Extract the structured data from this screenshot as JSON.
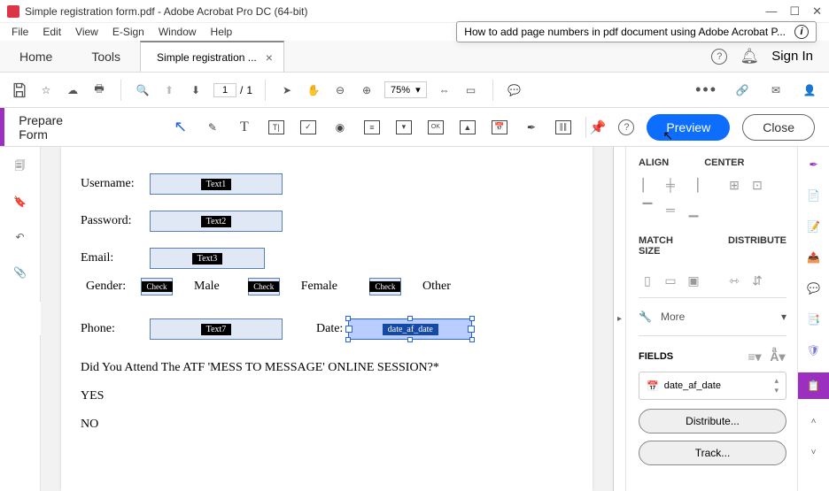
{
  "titlebar": {
    "text": "Simple registration form.pdf - Adobe Acrobat Pro DC (64-bit)"
  },
  "search_overlay": {
    "text": "How to add page numbers in pdf document using Adobe Acrobat P..."
  },
  "menubar": {
    "file": "File",
    "edit": "Edit",
    "view": "View",
    "esign": "E-Sign",
    "window": "Window",
    "help": "Help"
  },
  "tabbar": {
    "home": "Home",
    "tools": "Tools",
    "doc": "Simple registration ...",
    "signin": "Sign In"
  },
  "maintoolbar": {
    "page_cur": "1",
    "page_sep": "/",
    "page_total": "1",
    "zoom": "75%"
  },
  "formtoolbar": {
    "label": "Prepare Form",
    "preview": "Preview",
    "close": "Close"
  },
  "form": {
    "username_label": "Username:",
    "username_tag": "Text1",
    "password_label": "Password:",
    "password_tag": "Text2",
    "email_label": "Email:",
    "email_tag": "Text3",
    "gender_label": "Gender:",
    "check_tag": "Check",
    "male": "Male",
    "female": "Female",
    "other": "Other",
    "phone_label": "Phone:",
    "phone_tag": "Text7",
    "date_label": "Date:",
    "date_tag": "date_af_date",
    "question": "Did You Attend The ATF 'MESS TO MESSAGE' ONLINE SESSION?*",
    "yes": "YES",
    "no": "NO"
  },
  "rightpanel": {
    "align": "ALIGN",
    "center": "CENTER",
    "match": "MATCH SIZE",
    "distribute_h": "DISTRIBUTE",
    "more": "More",
    "fields": "FIELDS",
    "field_item": "date_af_date",
    "distribute_btn": "Distribute...",
    "track_btn": "Track..."
  }
}
